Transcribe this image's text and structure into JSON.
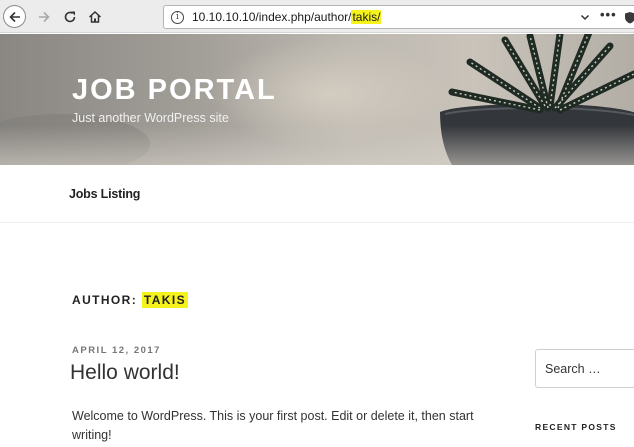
{
  "browser": {
    "url_prefix": "10.10.10.10/index.php/author/",
    "url_highlight": "takis/",
    "more_label": "•••",
    "icons": [
      "back-arrow-icon",
      "forward-arrow-icon",
      "reload-icon",
      "home-icon",
      "info-icon",
      "chevron-down-icon",
      "more-icon",
      "shield-icon"
    ]
  },
  "header": {
    "title": "JOB PORTAL",
    "tagline": "Just another WordPress site"
  },
  "nav": {
    "items": [
      {
        "label": "Jobs Listing"
      }
    ]
  },
  "archive": {
    "prefix": "AUTHOR:",
    "name": "TAKIS",
    "highlight_color": "#f5f31b"
  },
  "post": {
    "date": "APRIL 12, 2017",
    "title": "Hello world!",
    "excerpt": "Welcome to WordPress. This is your first post. Edit or delete it, then start writing!"
  },
  "sidebar": {
    "search_placeholder": "Search …",
    "recent_posts_title": "RECENT POSTS"
  }
}
